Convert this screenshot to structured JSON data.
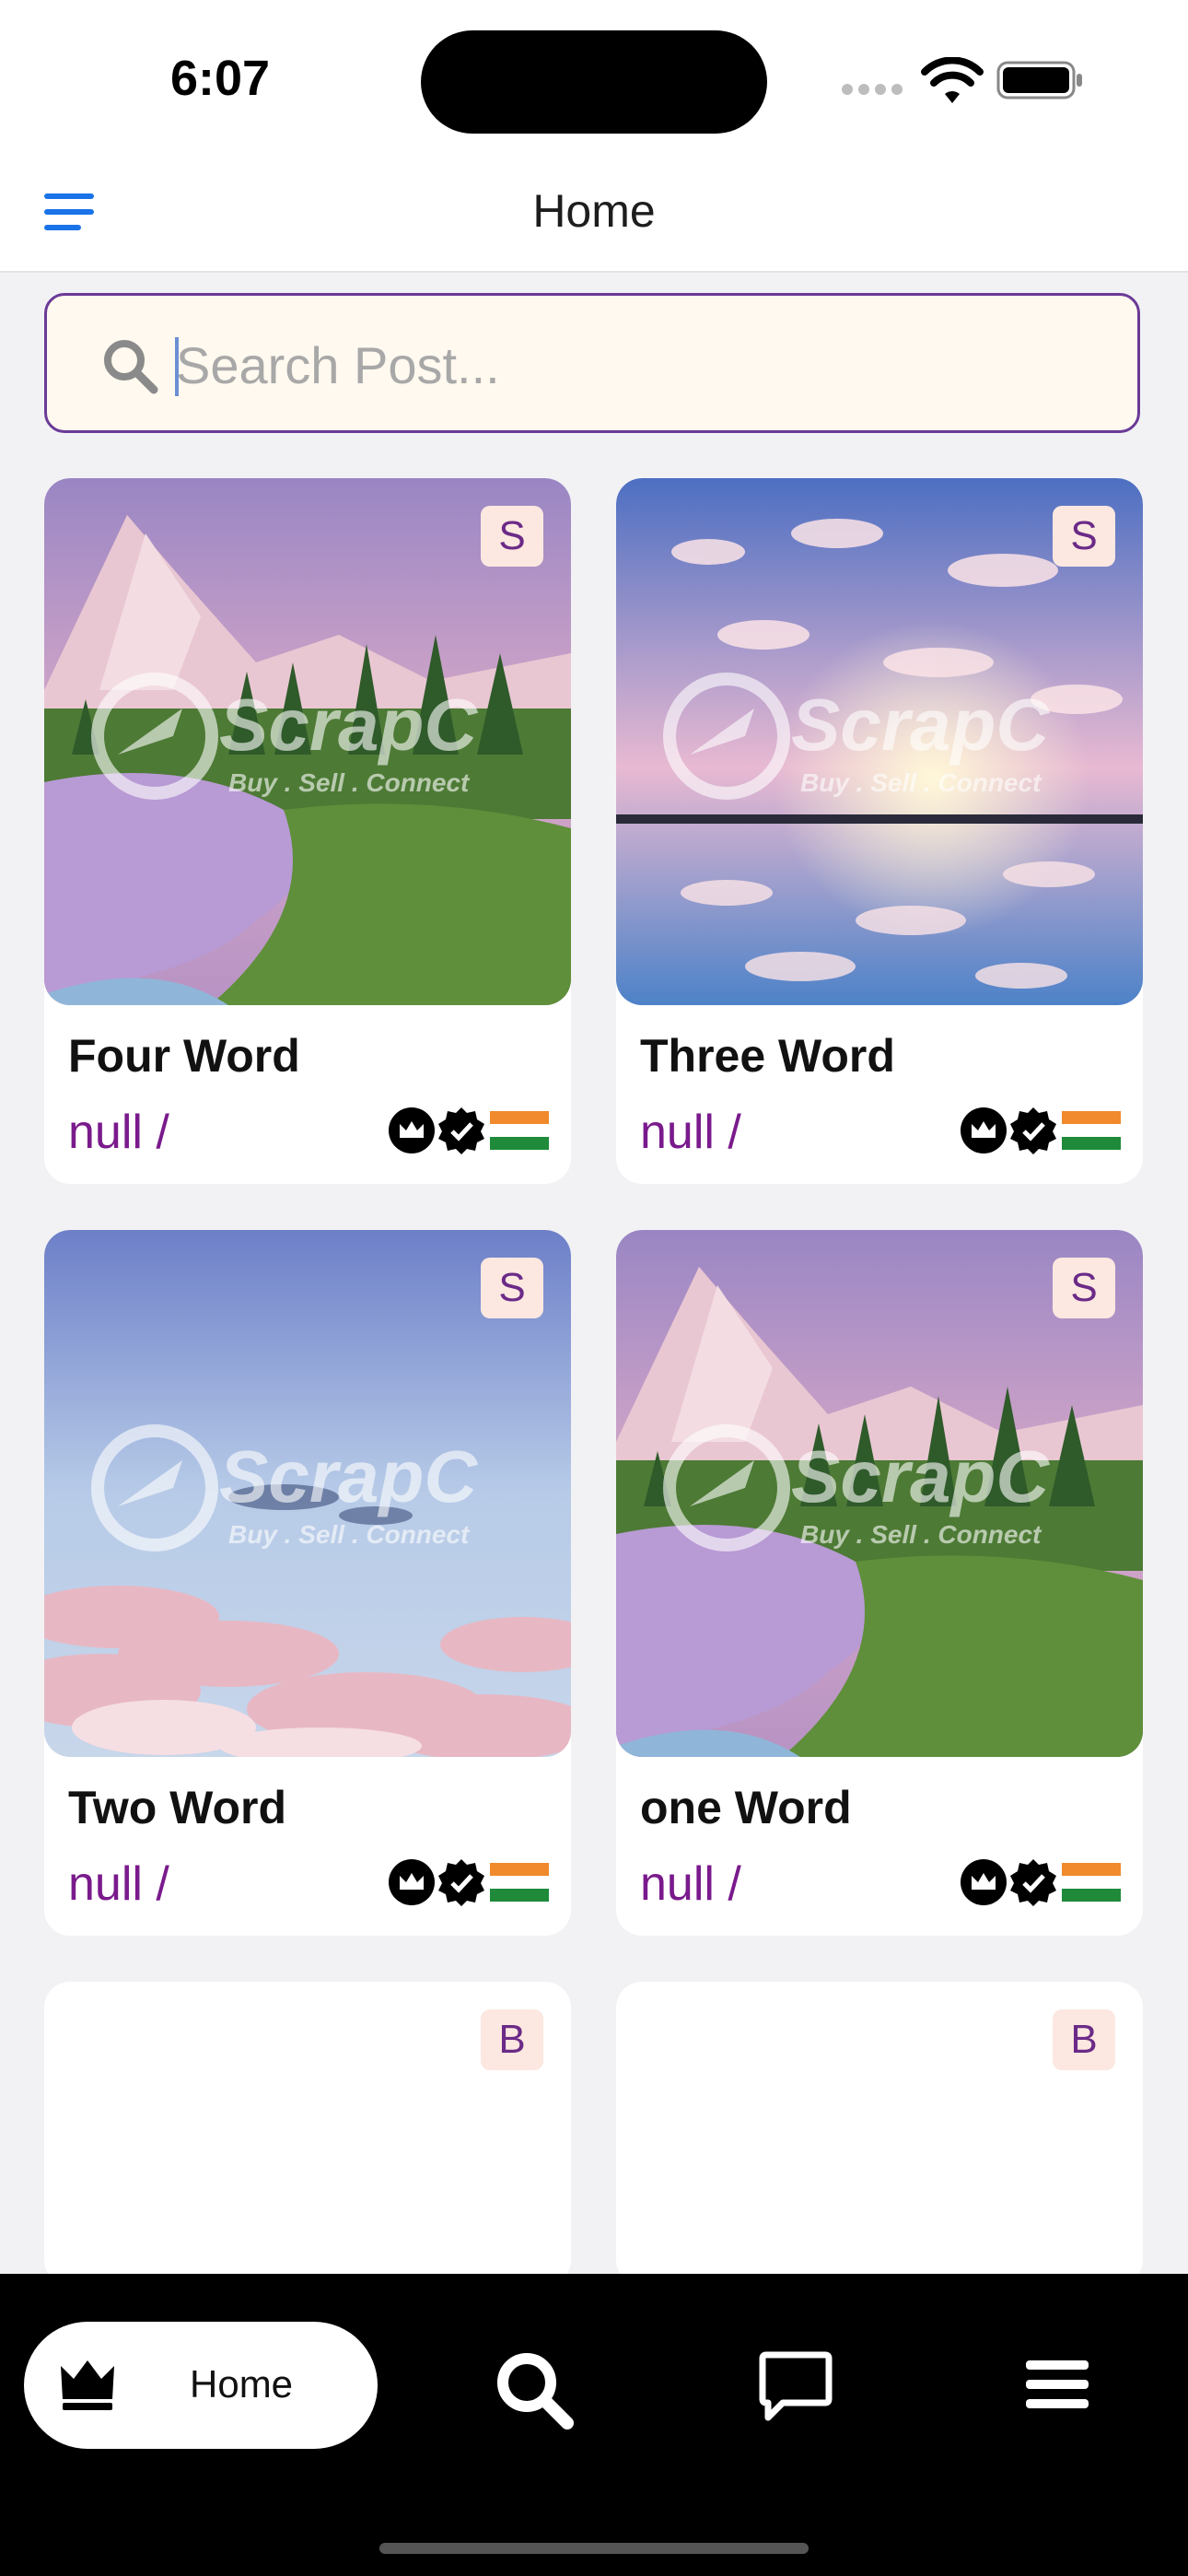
{
  "status_bar": {
    "time": "6:07"
  },
  "nav": {
    "title": "Home",
    "menu_icon": "hamburger-icon"
  },
  "search": {
    "placeholder": "Search Post...",
    "value": "",
    "icon": "search-icon"
  },
  "colors": {
    "accent": "#6b3a97",
    "price_text": "#7a1a8c",
    "badge_bg": "#fce8e0"
  },
  "posts": [
    {
      "badge": "S",
      "title": "Four Word",
      "subtitle": "null  /",
      "image": "mountain-lake-scene",
      "watermark": "ScrapC",
      "watermark_tagline": "Buy . Sell . Connect"
    },
    {
      "badge": "S",
      "title": "Three Word",
      "subtitle": "null  /",
      "image": "sunset-lake-scene",
      "watermark": "ScrapC",
      "watermark_tagline": "Buy . Sell . Connect"
    },
    {
      "badge": "S",
      "title": "Two Word",
      "subtitle": "null  /",
      "image": "sky-clouds-scene",
      "watermark": "ScrapC",
      "watermark_tagline": "Buy . Sell . Connect"
    },
    {
      "badge": "S",
      "title": "one Word",
      "subtitle": "null  /",
      "image": "mountain-lake-scene",
      "watermark": "ScrapC",
      "watermark_tagline": "Buy . Sell . Connect"
    },
    {
      "badge": "B",
      "title": "",
      "subtitle": ""
    },
    {
      "badge": "B",
      "title": "",
      "subtitle": ""
    }
  ],
  "tabbar": {
    "home_label": "Home",
    "items": [
      "crown-icon",
      "search-icon",
      "chat-icon",
      "menu-icon"
    ]
  }
}
